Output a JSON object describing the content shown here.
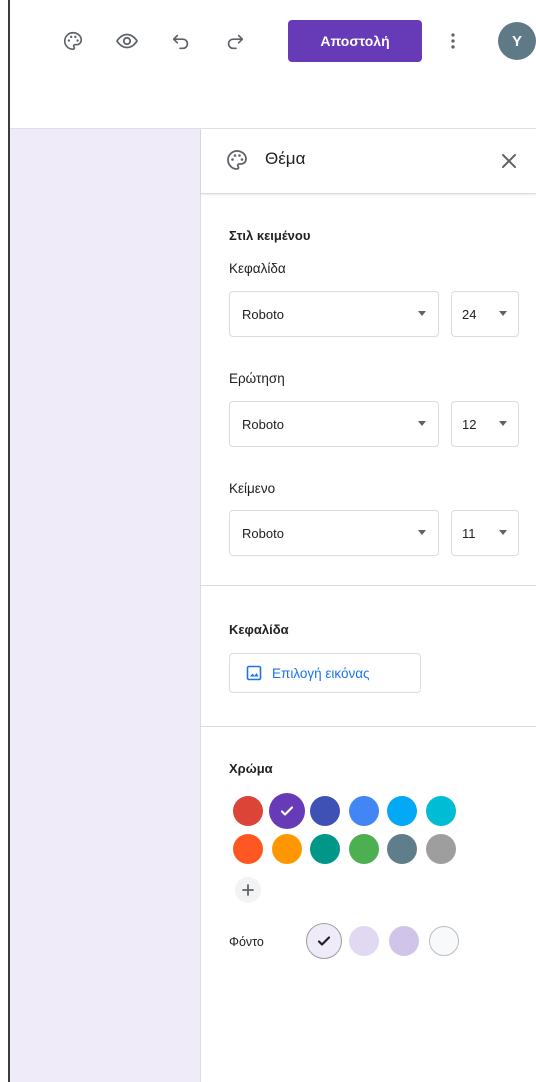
{
  "toolbar": {
    "icons": [
      "palette-icon",
      "eye-icon",
      "undo-icon",
      "redo-icon",
      "more-vert-icon"
    ],
    "send_label": "Αποστολή",
    "avatar_letter": "Y",
    "accent": "#673ab7"
  },
  "panel": {
    "title": "Θέμα",
    "text_style": {
      "title": "Στιλ κειμένου",
      "header": {
        "label": "Κεφαλίδα",
        "font": "Roboto",
        "size": "24"
      },
      "question": {
        "label": "Ερώτηση",
        "font": "Roboto",
        "size": "12"
      },
      "text": {
        "label": "Κείμενο",
        "font": "Roboto",
        "size": "11"
      }
    },
    "header_section": {
      "title": "Κεφαλίδα",
      "choose_image_label": "Επιλογή εικόνας"
    },
    "color_section": {
      "title": "Χρώμα",
      "colors": [
        "#db4437",
        "#673ab7",
        "#3f51b5",
        "#4285f4",
        "#03a9f4",
        "#00bcd4",
        "#ff5722",
        "#ff9800",
        "#009688",
        "#4caf50",
        "#607d8b",
        "#9e9e9e"
      ],
      "selected_color": "#673ab7",
      "background_label": "Φόντο",
      "backgrounds": [
        "#f0ebf8",
        "#e1d9f1",
        "#d1c4e9",
        "#f8f9fa"
      ],
      "selected_background": "#f0ebf8"
    }
  }
}
